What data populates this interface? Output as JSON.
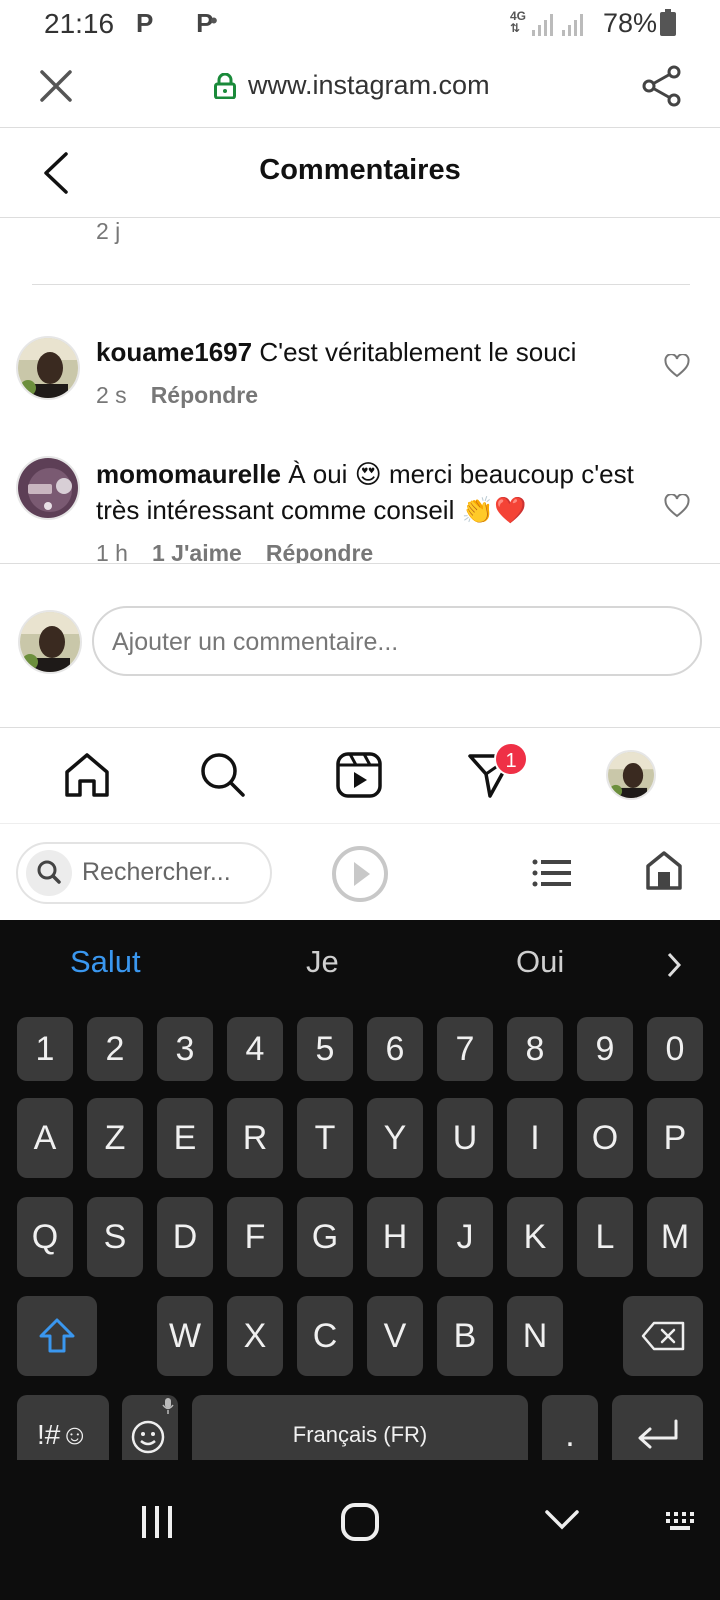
{
  "status_bar": {
    "time": "21:16",
    "notification_icons": "P P",
    "dot": "•",
    "network_type": "4G",
    "battery": "78%"
  },
  "browser": {
    "url": "www.instagram.com",
    "close_icon": "close-icon",
    "lock_icon": "lock-icon",
    "share_icon": "share-icon",
    "lock_color": "#1a8a3a"
  },
  "header": {
    "title": "Commentaires"
  },
  "comments": {
    "previous_time": "2 j",
    "items": [
      {
        "username": "kouame1697",
        "text": "C'est véritablement le souci",
        "time": "2 s",
        "reply_label": "Répondre"
      },
      {
        "username": "momomaurelle",
        "text": "À oui 😍 merci beaucoup c'est très intéressant comme conseil 👏❤️",
        "time": "1 h",
        "likes_label": "1 J'aime",
        "reply_label": "Répondre"
      }
    ]
  },
  "add_comment": {
    "placeholder": "Ajouter un commentaire..."
  },
  "ig_nav": {
    "items": [
      "home-icon",
      "search-icon",
      "reels-icon",
      "direct-icon",
      "profile-avatar"
    ],
    "direct_badge": "1",
    "badge_color": "#ef3046"
  },
  "browser_toolbar": {
    "search_placeholder": "Rechercher..."
  },
  "keyboard": {
    "suggestions": [
      "Salut",
      "Je",
      "Oui"
    ],
    "suggestion_primary_color": "#3a97ef",
    "number_row": [
      "1",
      "2",
      "3",
      "4",
      "5",
      "6",
      "7",
      "8",
      "9",
      "0"
    ],
    "row1": [
      "A",
      "Z",
      "E",
      "R",
      "T",
      "Y",
      "U",
      "I",
      "O",
      "P"
    ],
    "row2": [
      "Q",
      "S",
      "D",
      "F",
      "G",
      "H",
      "J",
      "K",
      "L",
      "M"
    ],
    "row3": [
      "W",
      "X",
      "C",
      "V",
      "B",
      "N"
    ],
    "symbols_label": "!#☺",
    "space_label": "Français (FR)",
    "period_label": "."
  },
  "system_nav": {
    "items": [
      "recents-icon",
      "home-icon",
      "back-icon",
      "keyboard-icon"
    ]
  }
}
